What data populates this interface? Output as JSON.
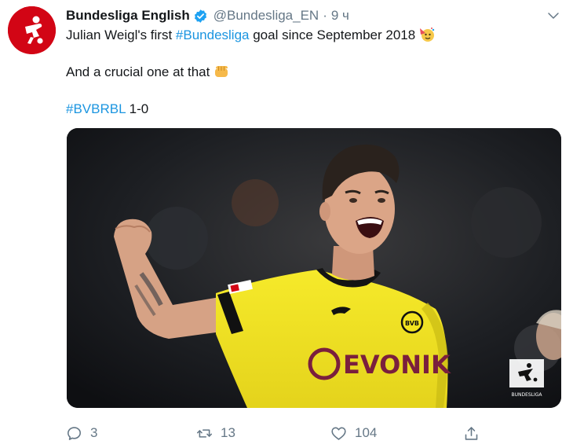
{
  "tweet": {
    "author_name": "Bundesliga English",
    "handle": "@Bundesliga_EN",
    "separator": "·",
    "time": "9 ч",
    "line1_text": "Julian Weigl's first ",
    "line1_hashtag": "#Bundesliga",
    "line1_rest": " goal since September 2018",
    "line1_emoji": "party-face-emoji",
    "line2_text": "And a crucial one at that",
    "line2_emoji": "fist-bump-emoji",
    "line3_hashtag": "#BVBRBL",
    "line3_rest": " 1-0",
    "media": {
      "sponsor_text": "EVONIK",
      "badge_text": "BVB",
      "watermark_text": "BUNDESLIGA"
    }
  },
  "actions": {
    "reply_count": "3",
    "retweet_count": "13",
    "like_count": "104"
  },
  "colors": {
    "brand_red": "#d20515",
    "link_blue": "#1b95e0",
    "muted_gray": "#657786",
    "jersey_yellow": "#f3e41f"
  },
  "icons": [
    "verified-badge-icon",
    "caret-down-icon",
    "reply-icon",
    "retweet-icon",
    "like-icon",
    "share-icon"
  ]
}
